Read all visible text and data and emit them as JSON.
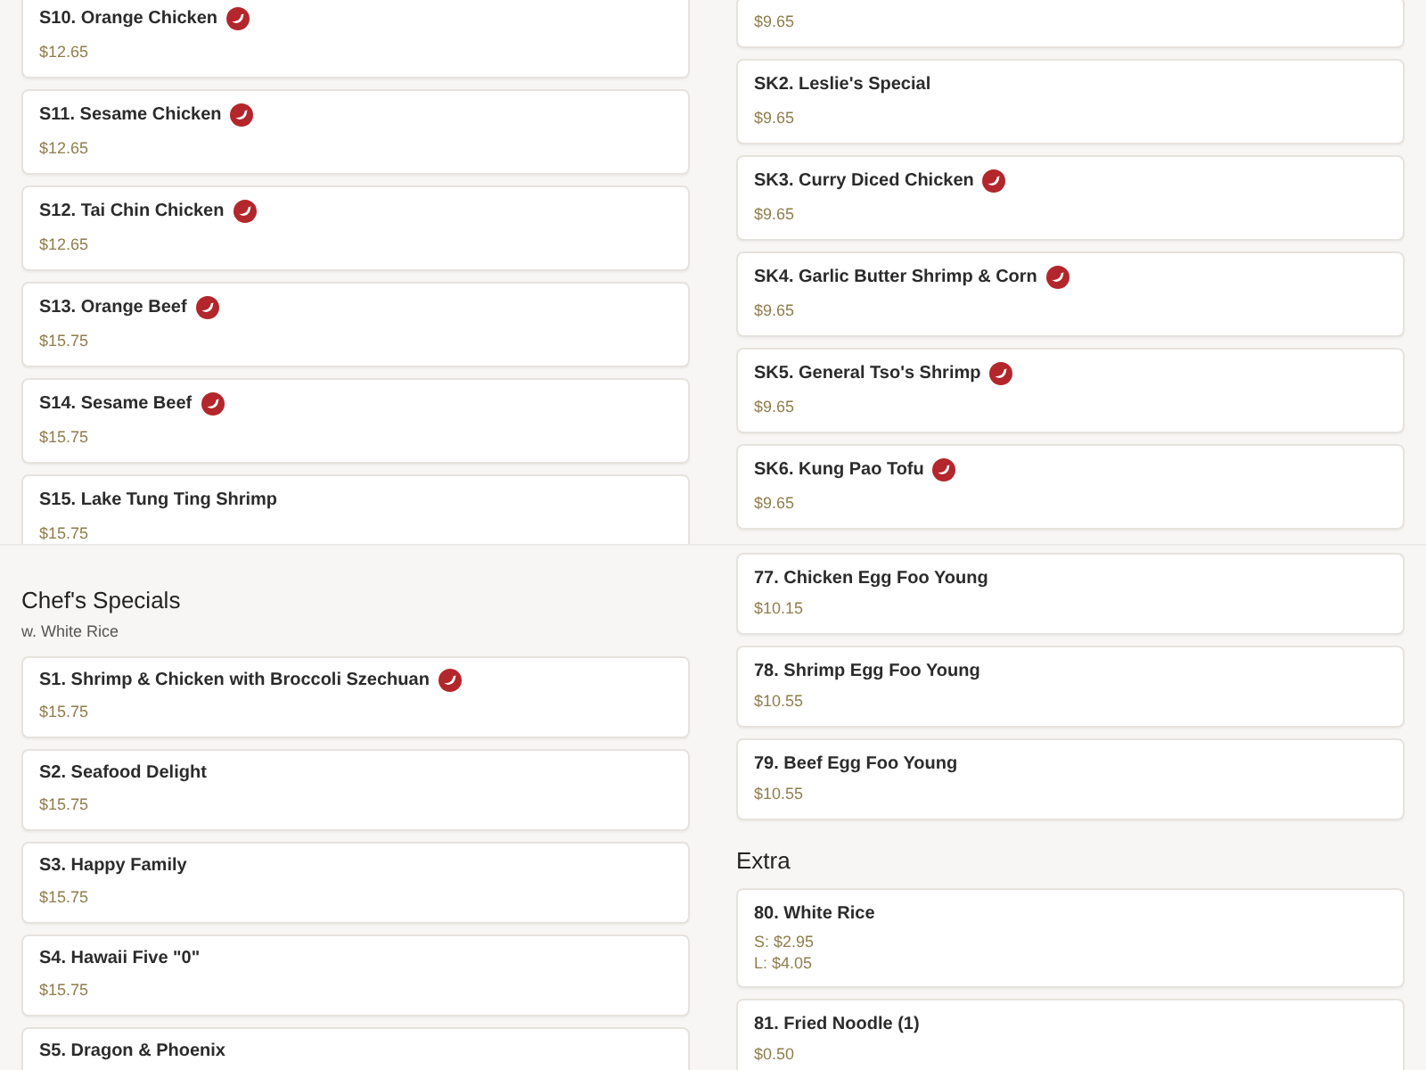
{
  "top_left": [
    {
      "name": "S10. Orange Chicken",
      "price": "$12.65",
      "spicy": true
    },
    {
      "name": "S11. Sesame Chicken",
      "price": "$12.65",
      "spicy": true
    },
    {
      "name": "S12. Tai Chin Chicken",
      "price": "$12.65",
      "spicy": true
    },
    {
      "name": "S13. Orange Beef",
      "price": "$15.75",
      "spicy": true
    },
    {
      "name": "S14. Sesame Beef",
      "price": "$15.75",
      "spicy": true
    },
    {
      "name": "S15. Lake Tung Ting Shrimp",
      "price": "$15.75",
      "spicy": false
    }
  ],
  "top_right": [
    {
      "price": "$9.65",
      "spicy": false
    },
    {
      "name": "SK2. Leslie's Special",
      "price": "$9.65",
      "spicy": false
    },
    {
      "name": "SK3. Curry Diced Chicken",
      "price": "$9.65",
      "spicy": true
    },
    {
      "name": "SK4. Garlic Butter Shrimp & Corn",
      "price": "$9.65",
      "spicy": true
    },
    {
      "name": "SK5. General Tso's Shrimp",
      "price": "$9.65",
      "spicy": true
    },
    {
      "name": "SK6. Kung Pao Tofu",
      "price": "$9.65",
      "spicy": true
    }
  ],
  "chefs_specials": {
    "title": "Chef's Specials",
    "note": "w. White Rice",
    "items": [
      {
        "name": "S1. Shrimp & Chicken with Broccoli Szechuan",
        "price": "$15.75",
        "spicy": true
      },
      {
        "name": "S2. Seafood Delight",
        "price": "$15.75",
        "spicy": false
      },
      {
        "name": "S3. Happy Family",
        "price": "$15.75",
        "spicy": false
      },
      {
        "name": "S4. Hawaii Five \"0\"",
        "price": "$15.75",
        "spicy": false
      },
      {
        "name": "S5. Dragon & Phoenix",
        "spicy": false
      }
    ]
  },
  "egg_foo_young_items": [
    {
      "name": "77. Chicken Egg Foo Young",
      "price": "$10.15",
      "spicy": false
    },
    {
      "name": "78. Shrimp Egg Foo Young",
      "price": "$10.55",
      "spicy": false
    },
    {
      "name": "79. Beef Egg Foo Young",
      "price": "$10.55",
      "spicy": false
    }
  ],
  "extra": {
    "title": "Extra",
    "items": [
      {
        "name": "80. White Rice",
        "prices": [
          "S: $2.95",
          "L: $4.05"
        ],
        "spicy": false
      },
      {
        "name": "81. Fried Noodle (1)",
        "price": "$0.50",
        "spicy": false
      }
    ]
  }
}
